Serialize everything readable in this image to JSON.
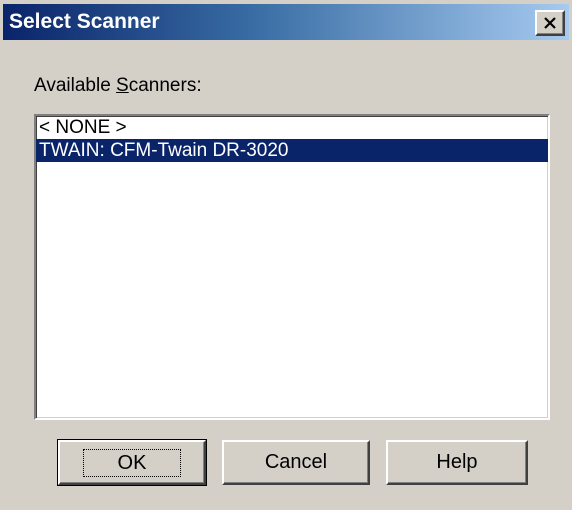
{
  "window": {
    "title": "Select Scanner",
    "close_icon": "close-icon"
  },
  "scanners": {
    "label_prefix": "Available ",
    "label_accel": "S",
    "label_suffix": "canners:",
    "items": [
      {
        "label": "< NONE >",
        "selected": false
      },
      {
        "label": "TWAIN: CFM-Twain DR-3020",
        "selected": true
      }
    ]
  },
  "buttons": {
    "ok": "OK",
    "cancel": "Cancel",
    "help": "Help"
  },
  "colors": {
    "face": "#d4d0c8",
    "title_start": "#0a246a",
    "title_end": "#a6caf0",
    "selection": "#0a246a"
  }
}
